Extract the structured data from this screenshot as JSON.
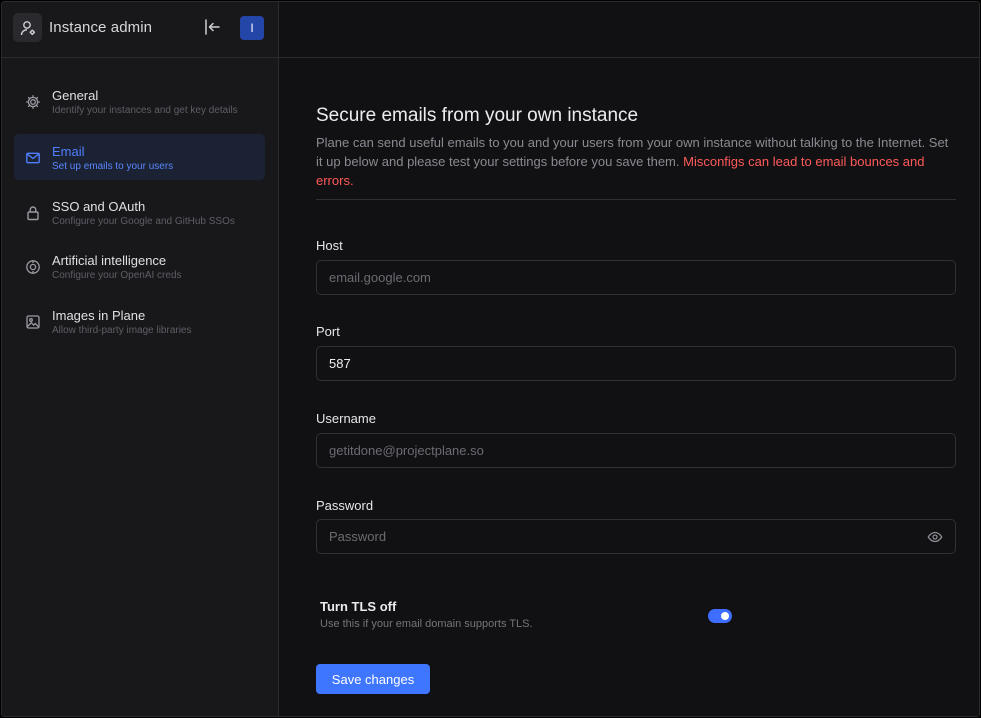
{
  "sidebar": {
    "app_title": "Instance admin",
    "user_initial": "I",
    "items": [
      {
        "label": "General",
        "description": "Identify your instances and get key details",
        "icon": "gear-icon",
        "active": false
      },
      {
        "label": "Email",
        "description": "Set up emails to your users",
        "icon": "mail-icon",
        "active": true
      },
      {
        "label": "SSO and OAuth",
        "description": "Configure your Google and GitHub SSOs",
        "icon": "lock-icon",
        "active": false
      },
      {
        "label": "Artificial intelligence",
        "description": "Configure your OpenAI creds",
        "icon": "ai-brain-icon",
        "active": false
      },
      {
        "label": "Images in Plane",
        "description": "Allow third-party image libraries",
        "icon": "image-icon",
        "active": false
      }
    ]
  },
  "main": {
    "title": "Secure emails from your own instance",
    "description": "Plane can send useful emails to you and your users from your own instance without talking to the Internet. Set it up below and please test your settings before you save them.",
    "warning": "Misconfigs can lead to email bounces and errors.",
    "fields": {
      "host": {
        "label": "Host",
        "value": "",
        "placeholder": "email.google.com"
      },
      "port": {
        "label": "Port",
        "value": "587",
        "placeholder": ""
      },
      "username": {
        "label": "Username",
        "value": "",
        "placeholder": "getitdone@projectplane.so"
      },
      "password": {
        "label": "Password",
        "value": "",
        "placeholder": "Password"
      }
    },
    "tls": {
      "label": "Turn TLS off",
      "description": "Use this if your email domain supports TLS.",
      "enabled": true
    },
    "save_label": "Save changes"
  },
  "colors": {
    "accent": "#3f76ff",
    "warning": "#ff5a5a",
    "active_nav": "#4f7fff"
  }
}
